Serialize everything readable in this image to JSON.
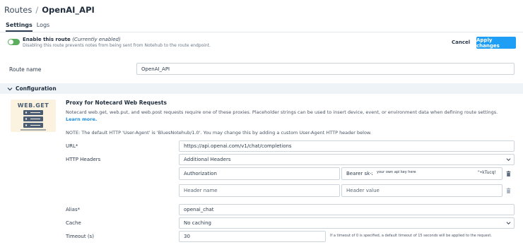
{
  "breadcrumb": {
    "parent": "Routes",
    "separator": "/",
    "current": "OpenAI_API"
  },
  "tabs": [
    {
      "label": "Settings"
    },
    {
      "label": "Logs"
    }
  ],
  "enable": {
    "title": "Enable this route",
    "status": "(Currently enabled)",
    "description": "Disabling this route prevents notes from being sent from Notehub to the route endpoint.",
    "enabled": true
  },
  "actions": {
    "cancel": "Cancel",
    "apply": "Apply changes"
  },
  "route_name": {
    "label": "Route name",
    "value": "OpenAI_API"
  },
  "config": {
    "title": "Configuration",
    "graphic_label": "WEB.GET",
    "proxy_title": "Proxy for Notecard Web Requests",
    "proxy_desc": "Notecard web.get, web.put, and web.post requests require one of these proxies. Placeholder strings can be used to insert device, event, or environment data when defining route settings.",
    "learn_more": "Learn more.",
    "note": "NOTE: The default HTTP 'User-Agent' is 'BluesNotehub/1.0'. You may change this by adding a custom User-Agent HTTP header below."
  },
  "fields": {
    "url": {
      "label": "URL*",
      "value": "https://api.openai.com/v1/chat/completions"
    },
    "headers": {
      "label": "HTTP Headers",
      "select": "Additional Headers",
      "rows": [
        {
          "name": "Authorization",
          "value_prefix": "Bearer sk-z",
          "value_overlay": "your own api key here",
          "value_suffix": "\"•kTucq!"
        },
        {
          "name_placeholder": "Header name",
          "value_placeholder": "Header value"
        }
      ]
    },
    "alias": {
      "label": "Alias*",
      "value": "openai_chat"
    },
    "cache": {
      "label": "Cache",
      "value": "No caching"
    },
    "timeout": {
      "label": "Timeout (s)",
      "value": "30",
      "hint": "If a timeout of 0 is specified, a default timeout of 15 seconds will be applied to the request."
    }
  },
  "icons": {
    "chevron": "chevron-down-icon",
    "trash": "trash-icon",
    "server": "server-icon"
  },
  "colors": {
    "accent": "#1e9ef4",
    "toggle_on": "#5aae5e",
    "config_bar": "#eef3f8",
    "graphic_bg": "#fbf3df"
  }
}
